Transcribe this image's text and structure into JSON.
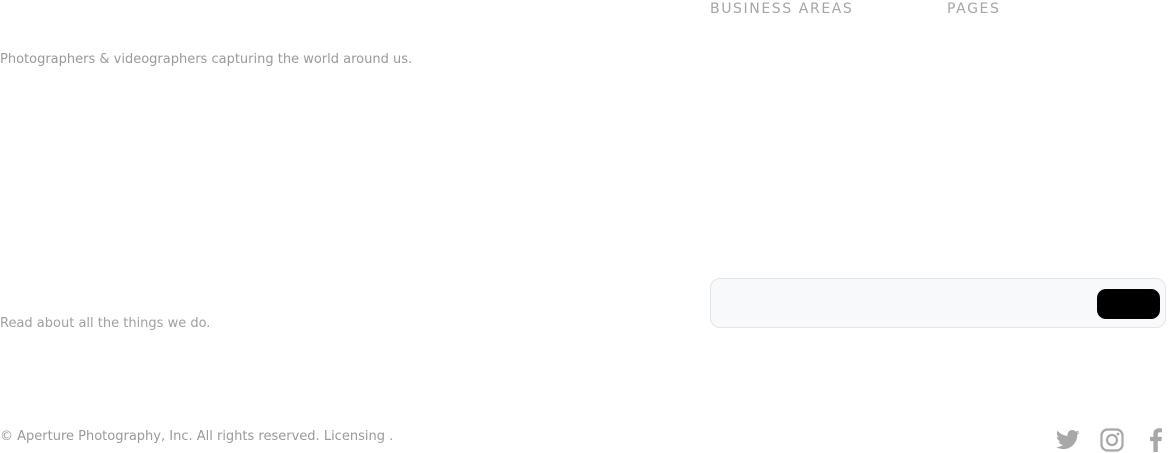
{
  "footer": {
    "tagline": "Photographers & videographers capturing the world around us.",
    "nav": {
      "business_areas_heading": "BUSINESS AREAS",
      "pages_heading": "PAGES"
    },
    "read_about": "Read about all the things we do.",
    "newsletter": {
      "input_value": "",
      "button_label": ""
    },
    "copyright": {
      "text": "© Aperture Photography, Inc. All rights reserved.",
      "licensing_link": "Licensing",
      "suffix": " ."
    },
    "social": [
      {
        "name": "twitter",
        "icon": "twitter-icon"
      },
      {
        "name": "instagram",
        "icon": "instagram-icon"
      },
      {
        "name": "facebook",
        "icon": "facebook-icon"
      }
    ],
    "colors": {
      "muted_text": "#9a9a9a",
      "icon": "#a8a8a8",
      "button": "#000000",
      "input_bg": "#f8f9fb"
    }
  }
}
